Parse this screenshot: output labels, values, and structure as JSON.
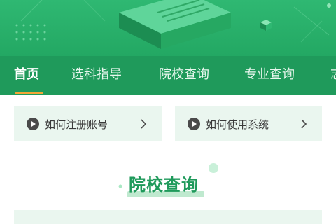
{
  "nav": {
    "items": [
      {
        "label": "首页",
        "active": true
      },
      {
        "label": "选科指导",
        "active": false
      },
      {
        "label": "院校查询",
        "active": false
      },
      {
        "label": "专业查询",
        "active": false
      },
      {
        "label": "志",
        "active": false
      }
    ]
  },
  "help": {
    "left_label": "如何注册账号",
    "right_label": "如何使用系统",
    "icons": [
      "play-icon",
      "chevron-right-icon"
    ]
  },
  "section": {
    "title": "院校查询"
  },
  "colors": {
    "brand_green": "#1f9a5b",
    "banner_green": "#2fb872",
    "accent_orange": "#f3a637",
    "card_bg": "#eaf6ef"
  }
}
